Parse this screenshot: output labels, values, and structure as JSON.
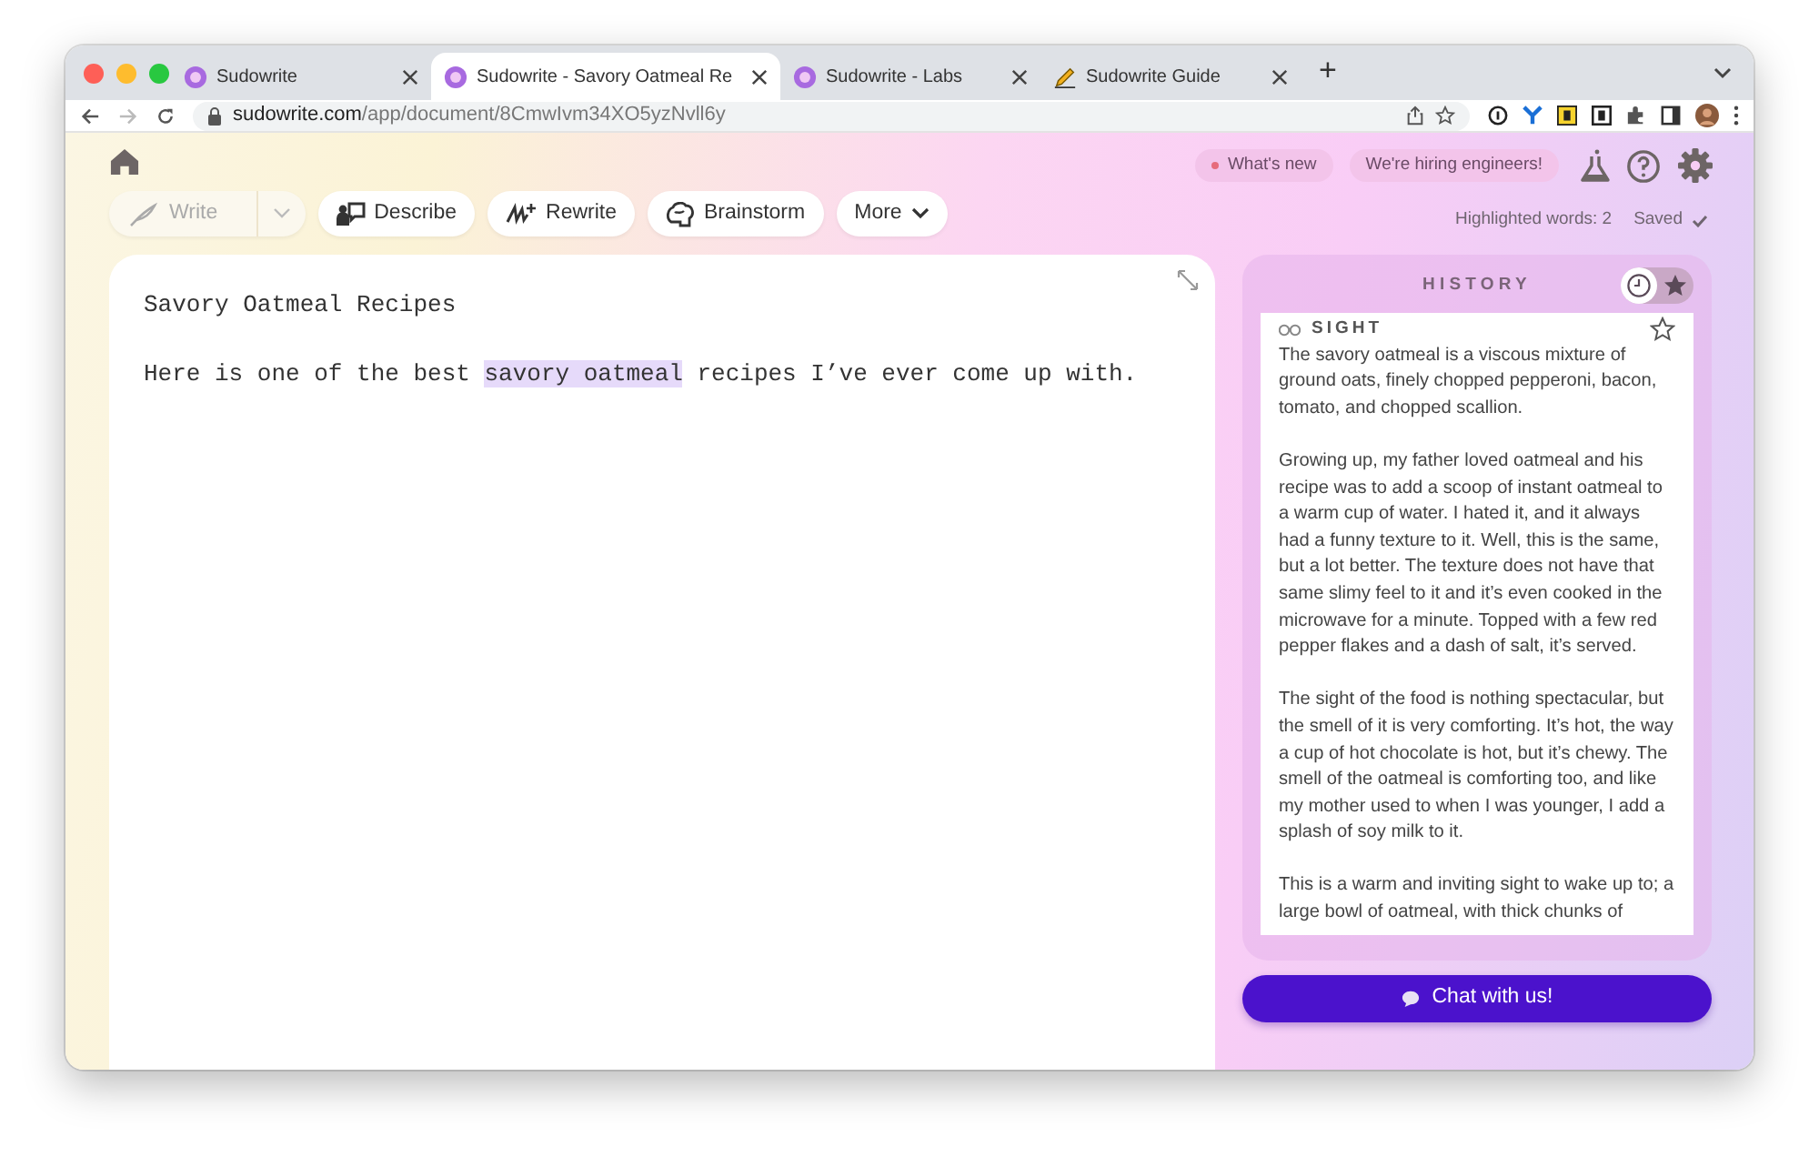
{
  "browser": {
    "tabs": [
      {
        "title": "Sudowrite",
        "kind": "app",
        "selected": false
      },
      {
        "title": "Sudowrite - Savory Oatmeal Re",
        "kind": "app",
        "selected": true
      },
      {
        "title": "Sudowrite - Labs",
        "kind": "app",
        "selected": false
      },
      {
        "title": "Sudowrite Guide",
        "kind": "guide",
        "selected": false
      }
    ],
    "new_tab": "+",
    "url": {
      "host": "sudowrite.com",
      "path": "/app/document/8CmwIvm34XO5yzNvll6y"
    }
  },
  "toolbar": [
    {
      "label": "Write",
      "kind": "split",
      "disabled": true
    },
    {
      "label": "Describe",
      "kind": "button",
      "disabled": false
    },
    {
      "label": "Rewrite",
      "kind": "button",
      "disabled": false
    },
    {
      "label": "Brainstorm",
      "kind": "button",
      "disabled": false
    },
    {
      "label": "More",
      "kind": "menu",
      "disabled": false
    }
  ],
  "header_pills": [
    {
      "label": "What's new",
      "unread": true
    },
    {
      "label": "We're hiring engineers!",
      "unread": false
    }
  ],
  "status": {
    "highlighted": "Highlighted words: 2",
    "saved": "Saved"
  },
  "editor": {
    "title": "Savory Oatmeal Recipes",
    "body": [
      {
        "text": "Here is one of the best ",
        "highlighted": false
      },
      {
        "text": "savory oatmeal",
        "highlighted": true
      },
      {
        "text": " recipes I’ve ever come up with.",
        "highlighted": false
      }
    ]
  },
  "history": {
    "title": "HISTORY",
    "views": [
      {
        "kind": "history",
        "selected": true
      },
      {
        "kind": "favorites",
        "selected": false
      }
    ],
    "entries": [
      {
        "label": "SIGHT",
        "starred": false,
        "paragraphs": [
          "The savory oatmeal is a viscous mixture of ground oats, finely chopped pepperoni, bacon, tomato, and chopped scallion.",
          "Growing up, my father loved oatmeal and his recipe was to add a scoop of instant oatmeal to a warm cup of water. I hated it, and it always had a funny texture to it. Well, this is the same, but a lot better. The texture does not have that same slimy feel to it and it’s even cooked in the microwave for a minute. Topped with a few red pepper flakes and a dash of salt, it’s served.",
          "The sight of the food is nothing spectacular, but the smell of it is very comforting. It’s hot, the way a cup of hot chocolate is hot, but it’s chewy. The smell of the oatmeal is comforting too, and like my mother used to when I was younger, I add a splash of soy milk to it.",
          "This is a warm and inviting sight to wake up to; a large bowl of oatmeal, with thick chunks of"
        ]
      }
    ]
  },
  "chat_button": "Chat with us!"
}
